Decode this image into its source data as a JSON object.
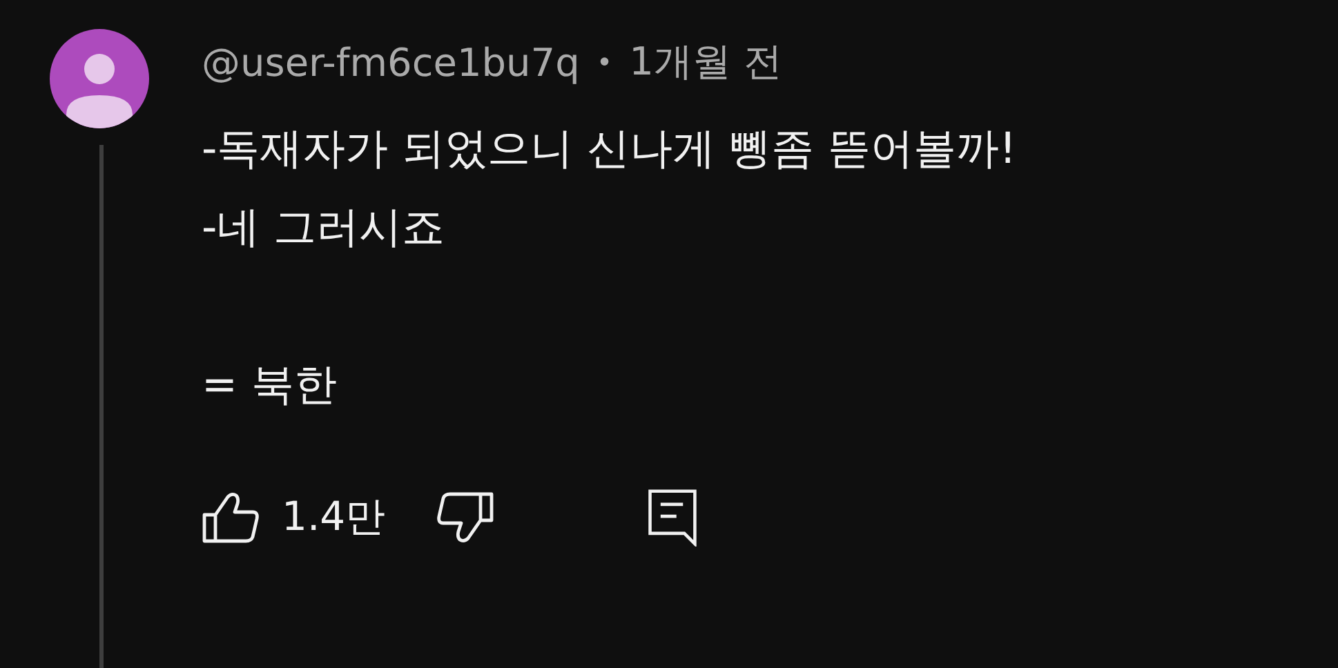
{
  "comment": {
    "author": "@user-fm6ce1bu7q",
    "separator": "•",
    "time": "1개월 전",
    "paragraphs": [
      "-독재자가 되었으니 신나게 뼹좀 뜯어볼까!\n-네 그러시죠",
      "= 북한"
    ],
    "likes": "1.4만",
    "liked": false,
    "disliked": false
  }
}
